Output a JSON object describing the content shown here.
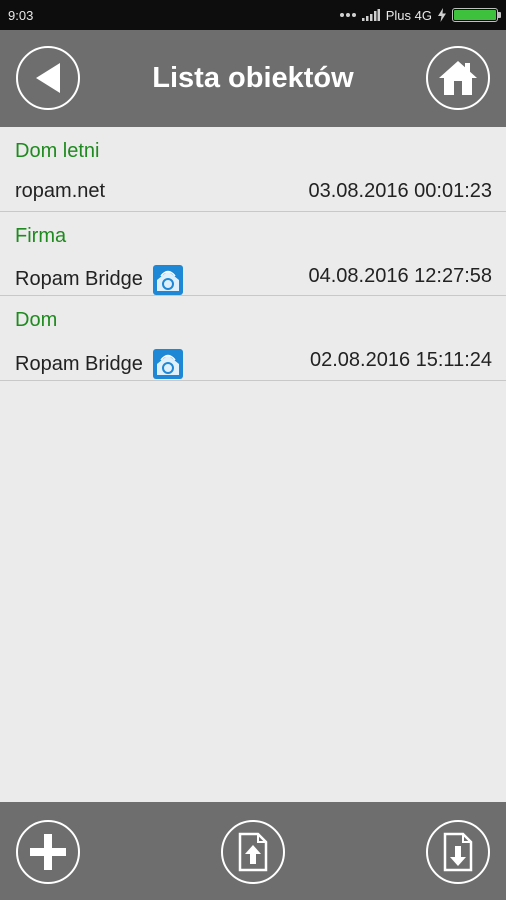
{
  "status_bar": {
    "time": "9:03",
    "carrier": "Plus 4G",
    "battery_color": "#3ec23e"
  },
  "header": {
    "title": "Lista obiektów",
    "back_icon": "back-arrow-icon",
    "home_icon": "home-icon"
  },
  "objects": [
    {
      "name": "Dom letni",
      "subtitle": "ropam.net",
      "date": "03.08.2016 00:01:23",
      "has_bridge_icon": false
    },
    {
      "name": "Firma",
      "subtitle": "Ropam Bridge",
      "date": "04.08.2016 12:27:58",
      "has_bridge_icon": true
    },
    {
      "name": "Dom",
      "subtitle": "Ropam Bridge",
      "date": "02.08.2016 15:11:24",
      "has_bridge_icon": true
    }
  ],
  "toolbar": {
    "add_icon": "plus-icon",
    "import_icon": "file-upload-icon",
    "export_icon": "file-download-icon"
  },
  "colors": {
    "accent_green": "#1f8a1f",
    "header_gray": "#6e6e6e",
    "background": "#ebebeb"
  }
}
